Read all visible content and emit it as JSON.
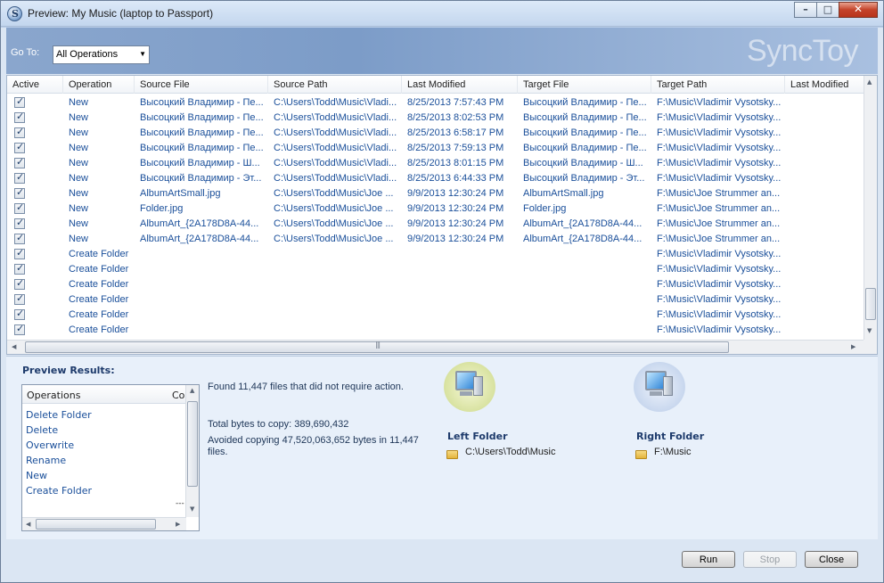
{
  "window": {
    "title": "Preview: My Music (laptop to Passport)",
    "app_icon_letter": "S",
    "buttons": {
      "minimize": "–",
      "maximize": "□",
      "close": "✕"
    }
  },
  "toolbar": {
    "goto_label": "Go To:",
    "goto_value": "All Operations",
    "brand": "SyncToy"
  },
  "grid": {
    "columns": [
      "Active",
      "Operation",
      "Source File",
      "Source Path",
      "Last Modified",
      "Target File",
      "Target Path",
      "Last Modified"
    ],
    "rows": [
      {
        "operation": "New",
        "source_file": "Высоцкий Владимир - Пе...",
        "source_path": "C:\\Users\\Todd\\Music\\Vladi...",
        "modified": "8/25/2013 7:57:43 PM",
        "target_file": "Высоцкий Владимир - Пе...",
        "target_path": "F:\\Music\\Vladimir Vysotsky..."
      },
      {
        "operation": "New",
        "source_file": "Высоцкий Владимир - Пе...",
        "source_path": "C:\\Users\\Todd\\Music\\Vladi...",
        "modified": "8/25/2013 8:02:53 PM",
        "target_file": "Высоцкий Владимир - Пе...",
        "target_path": "F:\\Music\\Vladimir Vysotsky..."
      },
      {
        "operation": "New",
        "source_file": "Высоцкий Владимир - Пе...",
        "source_path": "C:\\Users\\Todd\\Music\\Vladi...",
        "modified": "8/25/2013 6:58:17 PM",
        "target_file": "Высоцкий Владимир - Пе...",
        "target_path": "F:\\Music\\Vladimir Vysotsky..."
      },
      {
        "operation": "New",
        "source_file": "Высоцкий Владимир - Пе...",
        "source_path": "C:\\Users\\Todd\\Music\\Vladi...",
        "modified": "8/25/2013 7:59:13 PM",
        "target_file": "Высоцкий Владимир - Пе...",
        "target_path": "F:\\Music\\Vladimir Vysotsky..."
      },
      {
        "operation": "New",
        "source_file": "Высоцкий Владимир - Ш...",
        "source_path": "C:\\Users\\Todd\\Music\\Vladi...",
        "modified": "8/25/2013 8:01:15 PM",
        "target_file": "Высоцкий Владимир - Ш...",
        "target_path": "F:\\Music\\Vladimir Vysotsky..."
      },
      {
        "operation": "New",
        "source_file": "Высоцкий Владимир - Эт...",
        "source_path": "C:\\Users\\Todd\\Music\\Vladi...",
        "modified": "8/25/2013 6:44:33 PM",
        "target_file": "Высоцкий Владимир - Эт...",
        "target_path": "F:\\Music\\Vladimir Vysotsky..."
      },
      {
        "operation": "New",
        "source_file": "AlbumArtSmall.jpg",
        "source_path": "C:\\Users\\Todd\\Music\\Joe ...",
        "modified": "9/9/2013 12:30:24 PM",
        "target_file": "AlbumArtSmall.jpg",
        "target_path": "F:\\Music\\Joe Strummer an..."
      },
      {
        "operation": "New",
        "source_file": "Folder.jpg",
        "source_path": "C:\\Users\\Todd\\Music\\Joe ...",
        "modified": "9/9/2013 12:30:24 PM",
        "target_file": "Folder.jpg",
        "target_path": "F:\\Music\\Joe Strummer an..."
      },
      {
        "operation": "New",
        "source_file": "AlbumArt_{2A178D8A-44...",
        "source_path": "C:\\Users\\Todd\\Music\\Joe ...",
        "modified": "9/9/2013 12:30:24 PM",
        "target_file": "AlbumArt_{2A178D8A-44...",
        "target_path": "F:\\Music\\Joe Strummer an..."
      },
      {
        "operation": "New",
        "source_file": "AlbumArt_{2A178D8A-44...",
        "source_path": "C:\\Users\\Todd\\Music\\Joe ...",
        "modified": "9/9/2013 12:30:24 PM",
        "target_file": "AlbumArt_{2A178D8A-44...",
        "target_path": "F:\\Music\\Joe Strummer an..."
      },
      {
        "operation": "Create Folder",
        "source_file": "",
        "source_path": "",
        "modified": "",
        "target_file": "",
        "target_path": "F:\\Music\\Vladimir Vysotsky..."
      },
      {
        "operation": "Create Folder",
        "source_file": "",
        "source_path": "",
        "modified": "",
        "target_file": "",
        "target_path": "F:\\Music\\Vladimir Vysotsky..."
      },
      {
        "operation": "Create Folder",
        "source_file": "",
        "source_path": "",
        "modified": "",
        "target_file": "",
        "target_path": "F:\\Music\\Vladimir Vysotsky..."
      },
      {
        "operation": "Create Folder",
        "source_file": "",
        "source_path": "",
        "modified": "",
        "target_file": "",
        "target_path": "F:\\Music\\Vladimir Vysotsky..."
      },
      {
        "operation": "Create Folder",
        "source_file": "",
        "source_path": "",
        "modified": "",
        "target_file": "",
        "target_path": "F:\\Music\\Vladimir Vysotsky..."
      },
      {
        "operation": "Create Folder",
        "source_file": "",
        "source_path": "",
        "modified": "",
        "target_file": "",
        "target_path": "F:\\Music\\Vladimir Vysotsky..."
      }
    ]
  },
  "results": {
    "title": "Preview Results:",
    "ops_header": [
      "Operations",
      "Co"
    ],
    "ops_items": [
      "Delete Folder",
      "Delete",
      "Overwrite",
      "Rename",
      "New",
      "Create Folder"
    ],
    "ops_more": "---",
    "found_text": "Found 11,447 files that did not require action.",
    "total_bytes": "Total bytes to copy: 389,690,432",
    "avoided": "Avoided copying 47,520,063,652 bytes in 11,447 files.",
    "left_folder_title": "Left Folder",
    "left_folder_path": "C:\\Users\\Todd\\Music",
    "right_folder_title": "Right Folder",
    "right_folder_path": "F:\\Music"
  },
  "actions": {
    "run": "Run",
    "stop": "Stop",
    "close": "Close"
  }
}
